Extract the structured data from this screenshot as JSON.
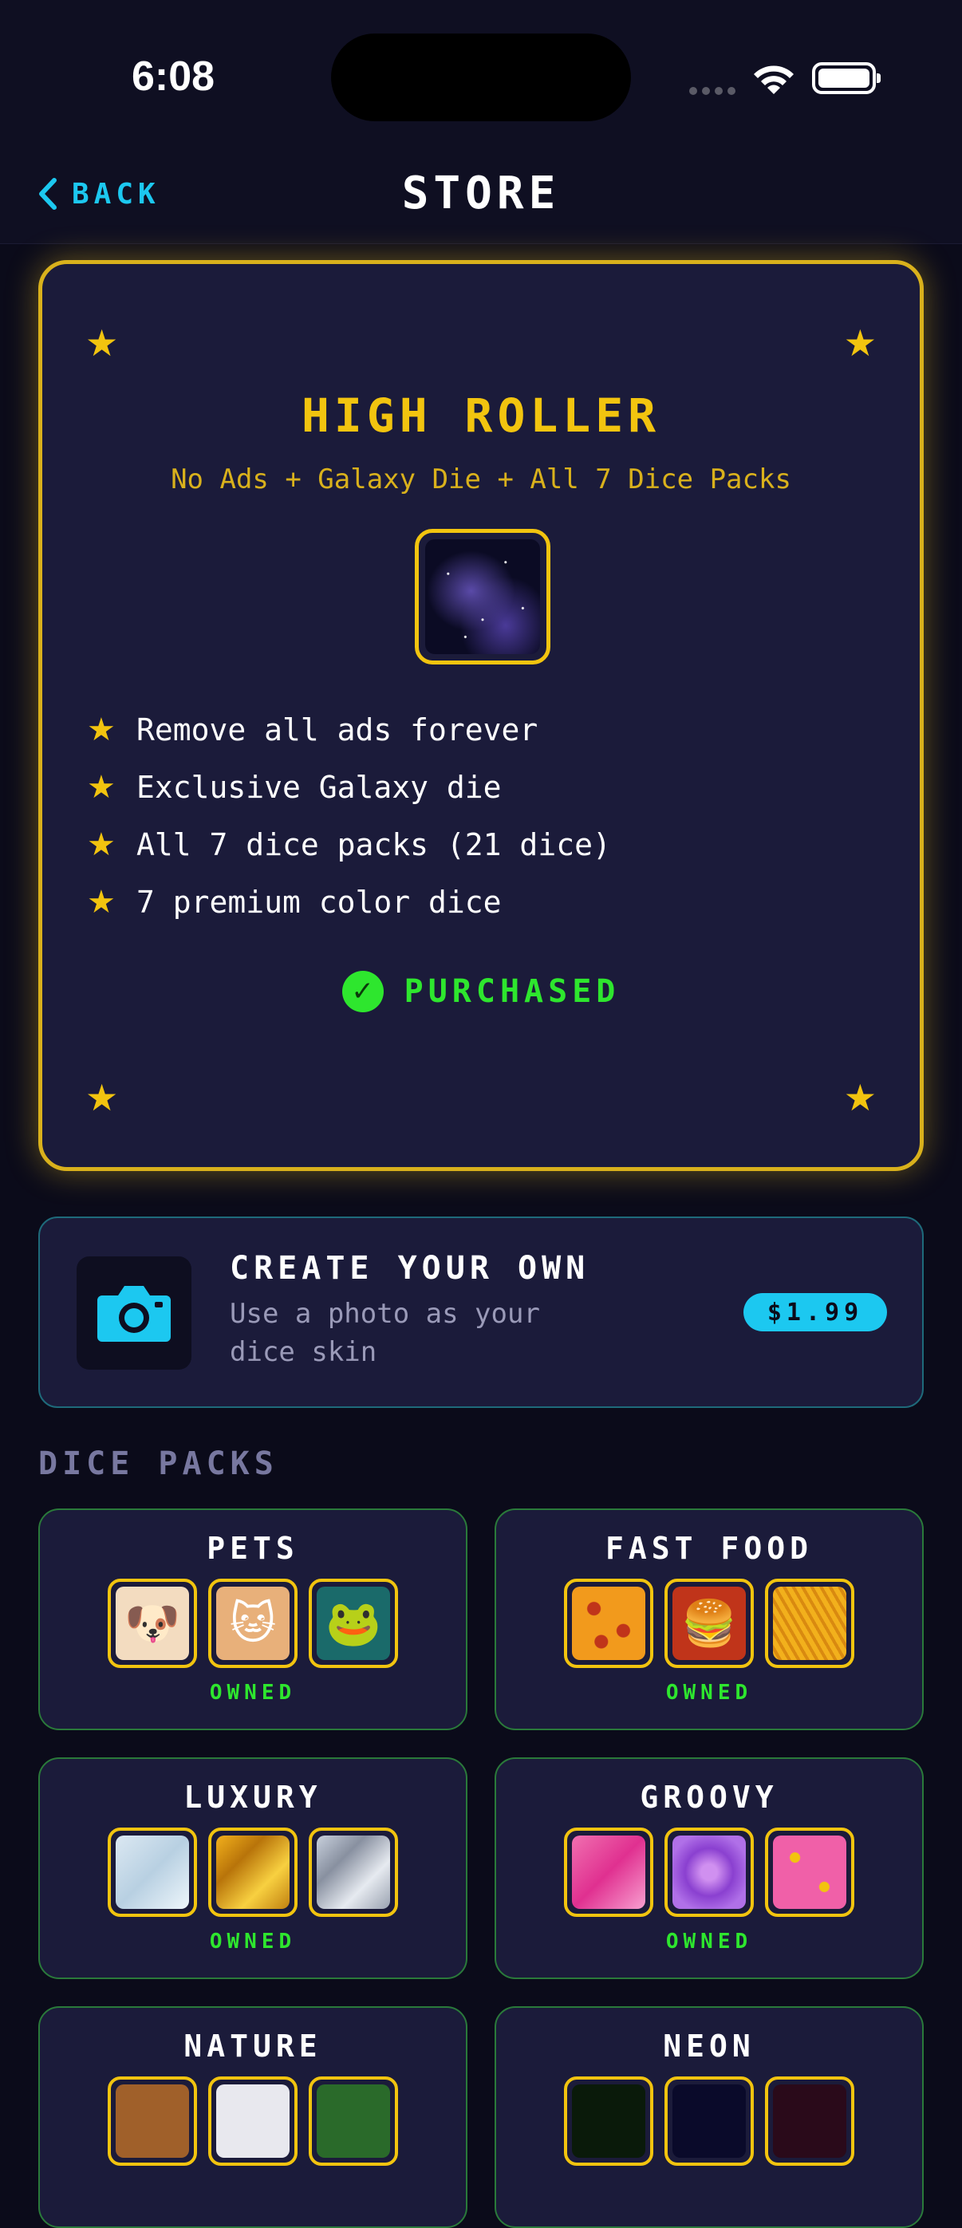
{
  "status_bar": {
    "time": "6:08"
  },
  "nav": {
    "back_label": "BACK",
    "title": "STORE"
  },
  "hero": {
    "title": "HIGH ROLLER",
    "subtitle": "No Ads + Galaxy Die + All 7 Dice Packs",
    "features": [
      "Remove all ads forever",
      "Exclusive Galaxy die",
      "All 7 dice packs (21 dice)",
      "7 premium color dice"
    ],
    "status_label": "PURCHASED"
  },
  "create": {
    "title": "CREATE YOUR OWN",
    "description": "Use a photo as your dice skin",
    "price": "$1.99"
  },
  "section_title": "DICE PACKS",
  "packs": [
    {
      "name": "PETS",
      "status": "OWNED"
    },
    {
      "name": "FAST FOOD",
      "status": "OWNED"
    },
    {
      "name": "LUXURY",
      "status": "OWNED"
    },
    {
      "name": "GROOVY",
      "status": "OWNED"
    },
    {
      "name": "NATURE",
      "status": ""
    },
    {
      "name": "NEON",
      "status": ""
    }
  ],
  "colors": {
    "accent_gold": "#f2c40f",
    "accent_cyan": "#1cc8f0",
    "owned_green": "#2ee62e",
    "background": "#0b0b1a",
    "card": "#1b1b3a"
  }
}
